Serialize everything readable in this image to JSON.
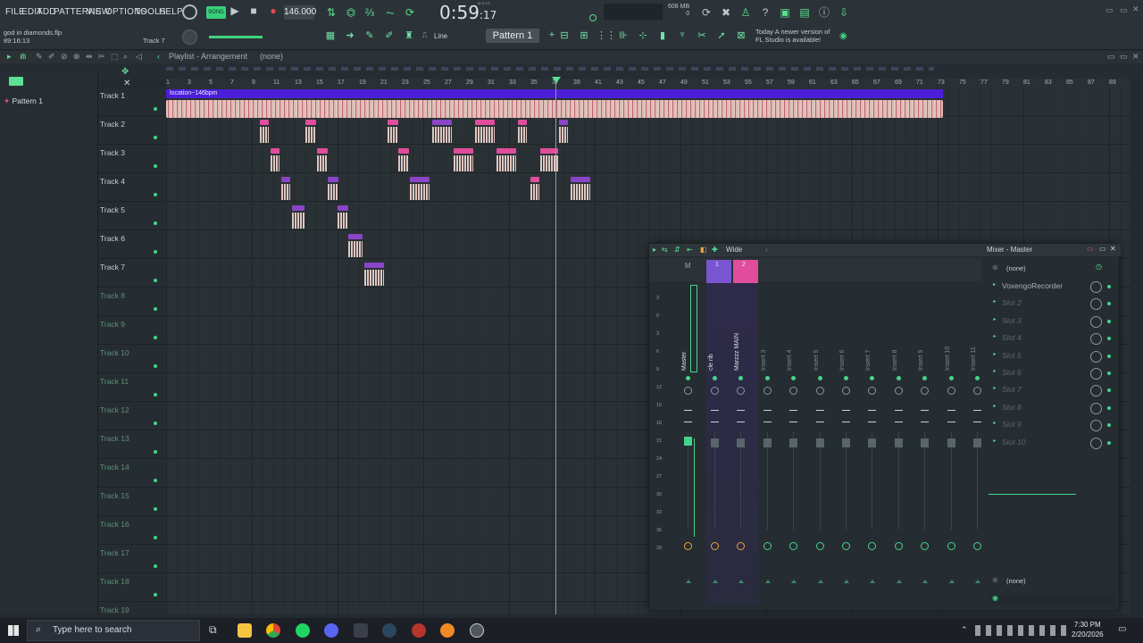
{
  "menu": [
    "FILE",
    "EDIT",
    "ADD",
    "PATTERNS",
    "VIEW",
    "OPTIONS",
    "TOOLS",
    "HELP"
  ],
  "transport": {
    "song_label": "SONG",
    "tempo": "146.000",
    "time_main": "0:59",
    "time_sub": ":17",
    "time_unit": "M:S:CS"
  },
  "cpu": {
    "memory": "608 MB",
    "line2": "0"
  },
  "project": {
    "file": "god in diamonds.flp",
    "position": "89:16:13",
    "hint": "Track 7"
  },
  "toolbar": {
    "snap": "Line",
    "pattern": "Pattern 1"
  },
  "notice": {
    "line1": "Today  A newer version of",
    "line2": "FL Studio is available!"
  },
  "playlist": {
    "title": "Playlist - Arrangement",
    "pattern_name": "(none)"
  },
  "patterns": [
    {
      "label": "Pattern 1"
    }
  ],
  "ruler": [
    "1",
    "3",
    "5",
    "7",
    "9",
    "11",
    "13",
    "15",
    "17",
    "19",
    "21",
    "23",
    "25",
    "27",
    "29",
    "31",
    "33",
    "35",
    "37",
    "39",
    "41",
    "43",
    "45",
    "47",
    "49",
    "51",
    "53",
    "55",
    "57",
    "59",
    "61",
    "63",
    "65",
    "67",
    "69",
    "71",
    "73",
    "75",
    "77",
    "79",
    "81",
    "83",
    "85",
    "87",
    "89"
  ],
  "tracks": [
    {
      "name": "Track 1"
    },
    {
      "name": "Track 2"
    },
    {
      "name": "Track 3"
    },
    {
      "name": "Track 4"
    },
    {
      "name": "Track 5"
    },
    {
      "name": "Track 6"
    },
    {
      "name": "Track 7"
    },
    {
      "name": "Track 8"
    },
    {
      "name": "Track 9"
    },
    {
      "name": "Track 10"
    },
    {
      "name": "Track 11"
    },
    {
      "name": "Track 12"
    },
    {
      "name": "Track 13"
    },
    {
      "name": "Track 14"
    },
    {
      "name": "Track 15"
    },
    {
      "name": "Track 16"
    },
    {
      "name": "Track 17"
    },
    {
      "name": "Track 18"
    },
    {
      "name": "Track 19"
    }
  ],
  "location_marker": "location~146bpm",
  "mixer": {
    "title": "Wide",
    "strips": [
      "Master",
      "cle rib",
      "Marzzz MAIN",
      "Insert 3",
      "Insert 4",
      "Insert 5",
      "Insert 6",
      "Insert 7",
      "Insert 8",
      "Insert 9",
      "Insert 10",
      "Insert 11"
    ],
    "routing_label": "M",
    "channel_nums": [
      "1",
      "2"
    ],
    "scale": [
      "3",
      "0",
      "3",
      "6",
      "9",
      "12",
      "15",
      "18",
      "21",
      "24",
      "27",
      "30",
      "33",
      "36",
      "39"
    ],
    "master_title": "Mixer - Master",
    "input": "(none)",
    "output": "(none)",
    "slots": [
      "VoxengoRecorder",
      "Slot 2",
      "Slot 3",
      "Slot 4",
      "Slot 5",
      "Slot 6",
      "Slot 7",
      "Slot 8",
      "Slot 9",
      "Slot 10"
    ]
  },
  "taskbar": {
    "search_placeholder": "Type here to search",
    "time": "7:30 PM",
    "date": "2/20/2026"
  },
  "colors": {
    "accent_green": "#46d38a",
    "clip_pink": "#e04d9c",
    "clip_purple": "#8a44c8",
    "location_blue": "#4b1fd8",
    "audio_pink": "#f4d7cf"
  }
}
